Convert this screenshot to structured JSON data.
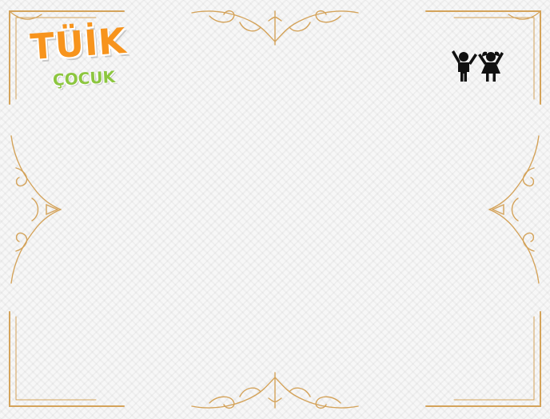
{
  "logo": {
    "title": "TÜİK",
    "subtitle": "ÇOCUK"
  },
  "icons": {
    "kids": "two-children-icon"
  },
  "colors": {
    "frame_gold": "#d4a35a",
    "logo_orange": "#f7941d",
    "logo_green": "#8cc63f",
    "icon_black": "#111111",
    "paper": "#f7f7f7"
  }
}
